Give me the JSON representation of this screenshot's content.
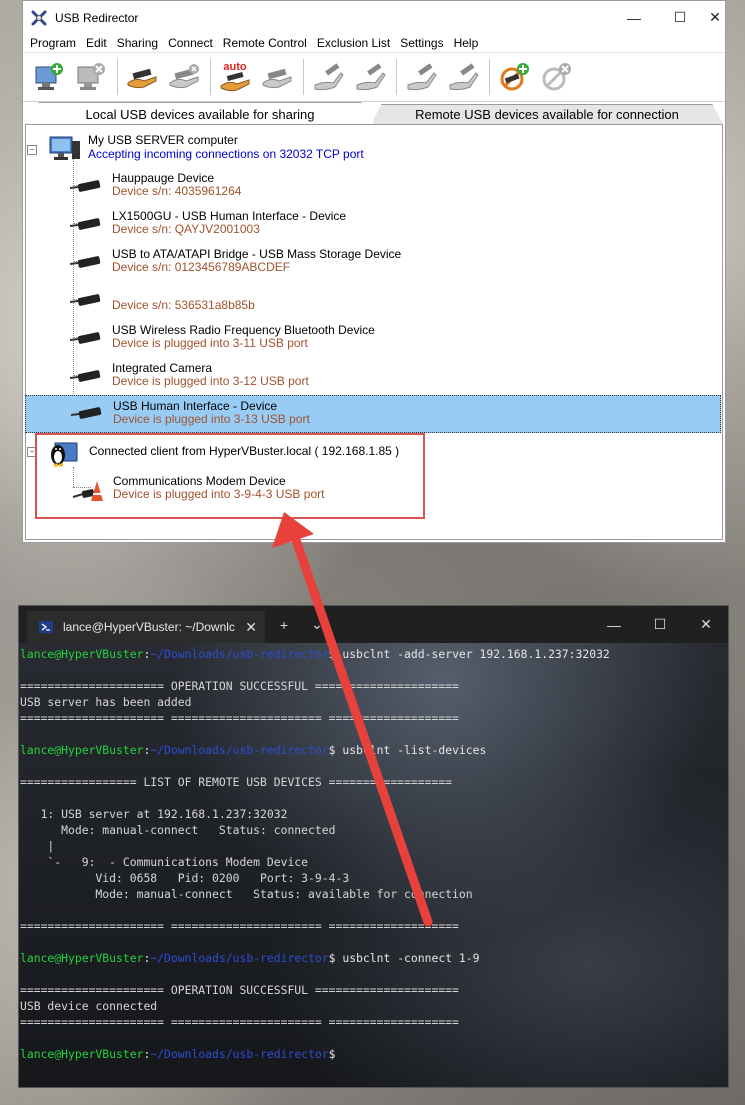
{
  "usb_window": {
    "title": "USB Redirector",
    "controls": {
      "minimize": "—",
      "maximize": "☐",
      "close": "✕"
    },
    "menu": [
      "Program",
      "Edit",
      "Sharing",
      "Connect",
      "Remote Control",
      "Exclusion List",
      "Settings",
      "Help"
    ],
    "toolbar": {
      "auto_label": "auto"
    },
    "tabs": {
      "local": "Local USB devices available for sharing",
      "remote": "Remote USB devices available for connection"
    },
    "server": {
      "name": "My USB SERVER computer",
      "status": "Accepting incoming connections on 32032 TCP port"
    },
    "devices": [
      {
        "name": "Hauppauge Device",
        "detail": "Device s/n: 4035961264"
      },
      {
        "name": "LX1500GU - USB Human Interface - Device",
        "detail": "Device s/n: QAYJV2001003"
      },
      {
        "name": "USB to ATA/ATAPI Bridge - USB Mass Storage Device",
        "detail": "Device s/n: 0123456789ABCDEF"
      },
      {
        "name": "",
        "detail": "Device s/n: 536531a8b85b"
      },
      {
        "name": "USB Wireless Radio Frequency Bluetooth Device",
        "detail": "Device is plugged into 3-11 USB port"
      },
      {
        "name": "Integrated Camera",
        "detail": "Device is plugged into 3-12 USB port"
      },
      {
        "name": "USB Human Interface - Device",
        "detail": "Device is plugged into 3-13 USB port"
      }
    ],
    "client": {
      "name": "Connected client from HyperVBuster.local ( 192.168.1.85 )",
      "device_name": "Communications Modem Device",
      "device_detail": "Device is plugged into 3-9-4-3 USB port"
    }
  },
  "terminal": {
    "tab_title": "lance@HyperVBuster: ~/Downlc",
    "new_tab": "+",
    "dropdown": "⌄",
    "controls": {
      "minimize": "—",
      "maximize": "☐",
      "close": "✕"
    },
    "prompt_user": "lance@HyperVBuster",
    "prompt_sep": ":",
    "prompt_path": "~/Downloads/usb-redirector",
    "prompt_end": "$",
    "lines": [
      {
        "kind": "prompt",
        "cmd": " usbclnt -add-server 192.168.1.237:32032"
      },
      {
        "kind": "blank",
        "text": ""
      },
      {
        "kind": "text",
        "text": "===================== OPERATION SUCCESSFUL ====================="
      },
      {
        "kind": "text",
        "text": "USB server has been added"
      },
      {
        "kind": "text",
        "text": "===================== ====================== ==================="
      },
      {
        "kind": "blank",
        "text": ""
      },
      {
        "kind": "prompt",
        "cmd": " usbclnt -list-devices"
      },
      {
        "kind": "blank",
        "text": ""
      },
      {
        "kind": "text",
        "text": "================= LIST OF REMOTE USB DEVICES =================="
      },
      {
        "kind": "blank",
        "text": ""
      },
      {
        "kind": "text",
        "text": "   1: USB server at 192.168.1.237:32032"
      },
      {
        "kind": "text",
        "text": "      Mode: manual-connect   Status: connected"
      },
      {
        "kind": "text",
        "text": "    |"
      },
      {
        "kind": "text",
        "text": "    `-   9:  - Communications Modem Device"
      },
      {
        "kind": "text",
        "text": "           Vid: 0658   Pid: 0200   Port: 3-9-4-3"
      },
      {
        "kind": "text",
        "text": "           Mode: manual-connect   Status: available for connection"
      },
      {
        "kind": "blank",
        "text": ""
      },
      {
        "kind": "text",
        "text": "===================== ====================== ==================="
      },
      {
        "kind": "blank",
        "text": ""
      },
      {
        "kind": "prompt",
        "cmd": " usbclnt -connect 1-9"
      },
      {
        "kind": "blank",
        "text": ""
      },
      {
        "kind": "text",
        "text": "===================== OPERATION SUCCESSFUL ====================="
      },
      {
        "kind": "text",
        "text": "USB device connected"
      },
      {
        "kind": "text",
        "text": "===================== ====================== ==================="
      },
      {
        "kind": "blank",
        "text": ""
      },
      {
        "kind": "prompt",
        "cmd": ""
      }
    ]
  },
  "colors": {
    "selection": "#99ccf5",
    "highlight_box": "#d9534f",
    "prompt_user": "#22d33b",
    "prompt_path": "#2b4ed6",
    "device_detail": "#a0522d",
    "server_status": "#0000cc"
  }
}
